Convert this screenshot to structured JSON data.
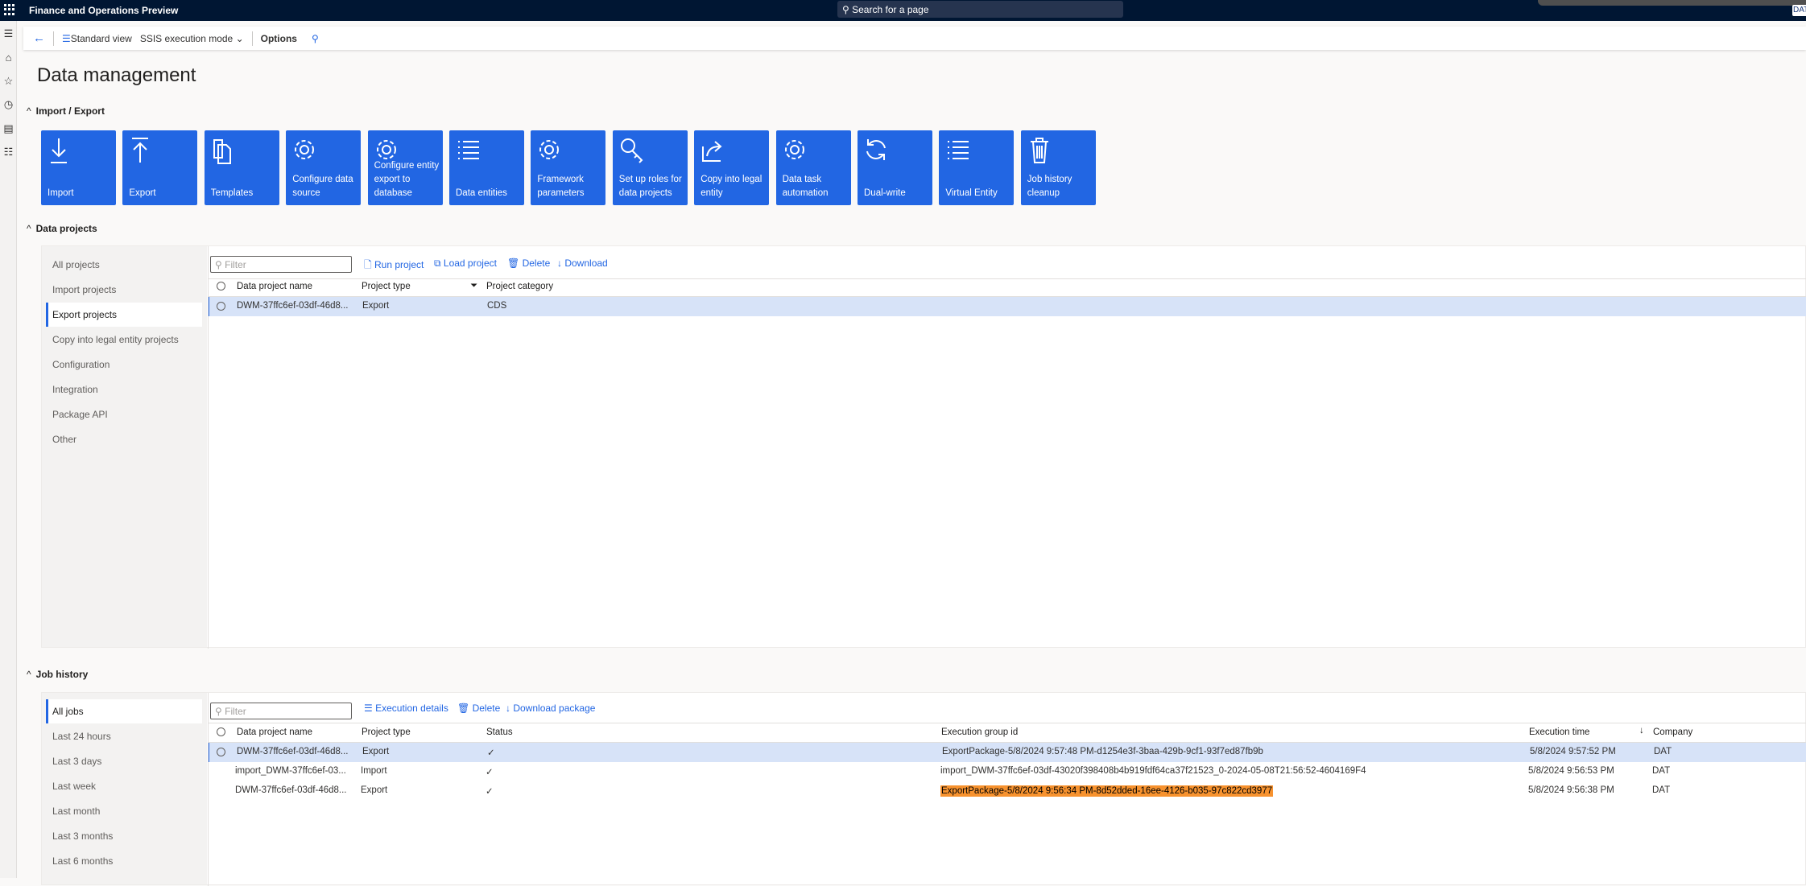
{
  "app": {
    "title": "Finance and Operations Preview",
    "search_placeholder": "Search for a page",
    "company": "DAT"
  },
  "toolbar": {
    "standard_view": "Standard view",
    "ssis_mode": "SSIS execution mode",
    "options": "Options"
  },
  "page": {
    "title": "Data management"
  },
  "import_export": {
    "header": "Import / Export",
    "tiles": [
      {
        "label": "Import",
        "icon": "import-icon"
      },
      {
        "label": "Export",
        "icon": "export-icon"
      },
      {
        "label": "Templates",
        "icon": "templates-icon"
      },
      {
        "label": "Configure data source",
        "icon": "gear-icon"
      },
      {
        "label": "Configure entity export to database",
        "icon": "gear-icon"
      },
      {
        "label": "Data entities",
        "icon": "list-icon"
      },
      {
        "label": "Framework parameters",
        "icon": "gear-icon"
      },
      {
        "label": "Set up roles for data projects",
        "icon": "key-icon"
      },
      {
        "label": "Copy into legal entity",
        "icon": "share-icon"
      },
      {
        "label": "Data task automation",
        "icon": "gear-icon"
      },
      {
        "label": "Dual-write",
        "icon": "refresh-icon"
      },
      {
        "label": "Virtual Entity",
        "icon": "list-icon"
      },
      {
        "label": "Job history cleanup",
        "icon": "trash-icon"
      }
    ]
  },
  "data_projects": {
    "header": "Data projects",
    "nav": [
      "All projects",
      "Import projects",
      "Export projects",
      "Copy into legal entity projects",
      "Configuration",
      "Integration",
      "Package API",
      "Other"
    ],
    "selected_nav": 2,
    "filter_placeholder": "Filter",
    "actions": [
      "Run project",
      "Load project",
      "Delete",
      "Download"
    ],
    "columns": [
      "Data project name",
      "Project type",
      "Project category"
    ],
    "rows": [
      {
        "name": "DWM-37ffc6ef-03df-46d8...",
        "type": "Export",
        "category": "CDS"
      }
    ]
  },
  "job_history": {
    "header": "Job history",
    "nav": [
      "All jobs",
      "Last 24 hours",
      "Last 3 days",
      "Last week",
      "Last month",
      "Last 3 months",
      "Last 6 months"
    ],
    "selected_nav": 0,
    "filter_placeholder": "Filter",
    "actions": [
      "Execution details",
      "Delete",
      "Download package"
    ],
    "columns": [
      "Data project name",
      "Project type",
      "Status",
      "Execution group id",
      "Execution time",
      "Company"
    ],
    "rows": [
      {
        "name": "DWM-37ffc6ef-03df-46d8...",
        "type": "Export",
        "status": "✓",
        "group": "ExportPackage-5/8/2024 9:57:48 PM-d1254e3f-3baa-429b-9cf1-93f7ed87fb9b",
        "time": "5/8/2024 9:57:52 PM",
        "company": "DAT"
      },
      {
        "name": "import_DWM-37ffc6ef-03...",
        "type": "Import",
        "status": "✓",
        "group": "import_DWM-37ffc6ef-03df-43020f398408b4b919fdf64ca37f21523_0-2024-05-08T21:56:52-4604169F4",
        "time": "5/8/2024 9:56:53 PM",
        "company": "DAT"
      },
      {
        "name": "DWM-37ffc6ef-03df-46d8...",
        "type": "Export",
        "status": "✓",
        "group": "ExportPackage-5/8/2024 9:56:34 PM-8d52dded-16ee-4126-b035-97c822cd3977",
        "time": "5/8/2024 9:56:38 PM",
        "company": "DAT"
      }
    ]
  },
  "colors": {
    "accent": "#2266e3",
    "topbar": "#001633",
    "selected_row": "#d7e3f8",
    "highlight": "#f7922e"
  }
}
